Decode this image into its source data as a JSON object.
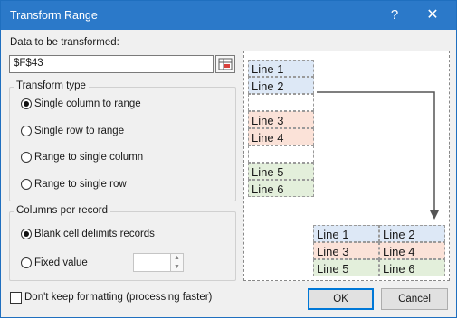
{
  "window": {
    "title": "Transform Range",
    "help": "?",
    "close": "✕"
  },
  "data_label": "Data to be transformed:",
  "range_value": "$F$43",
  "transform_type": {
    "legend": "Transform type",
    "options": [
      {
        "label": "Single column to range",
        "selected": true
      },
      {
        "label": "Single row to range",
        "selected": false
      },
      {
        "label": "Range to single column",
        "selected": false
      },
      {
        "label": "Range to single row",
        "selected": false
      }
    ]
  },
  "columns_per_record": {
    "legend": "Columns per record",
    "blank_label": "Blank cell delimits records",
    "blank_selected": true,
    "fixed_label": "Fixed value",
    "fixed_selected": false,
    "fixed_value": ""
  },
  "keep_format_label": "Don't keep formatting (processing faster)",
  "keep_format_checked": false,
  "buttons": {
    "ok": "OK",
    "cancel": "Cancel"
  },
  "preview": {
    "source": [
      "Line 1",
      "Line 2",
      "",
      "Line 3",
      "Line 4",
      "",
      "Line 5",
      "Line 6"
    ],
    "result": [
      [
        "Line 1",
        "Line 2"
      ],
      [
        "Line 3",
        "Line 4"
      ],
      [
        "Line 5",
        "Line 6"
      ]
    ]
  },
  "colors": {
    "blue": "#dde8f6",
    "red": "#fbe2d8",
    "green": "#e3efdb",
    "title_bar": "#2b79c9"
  }
}
